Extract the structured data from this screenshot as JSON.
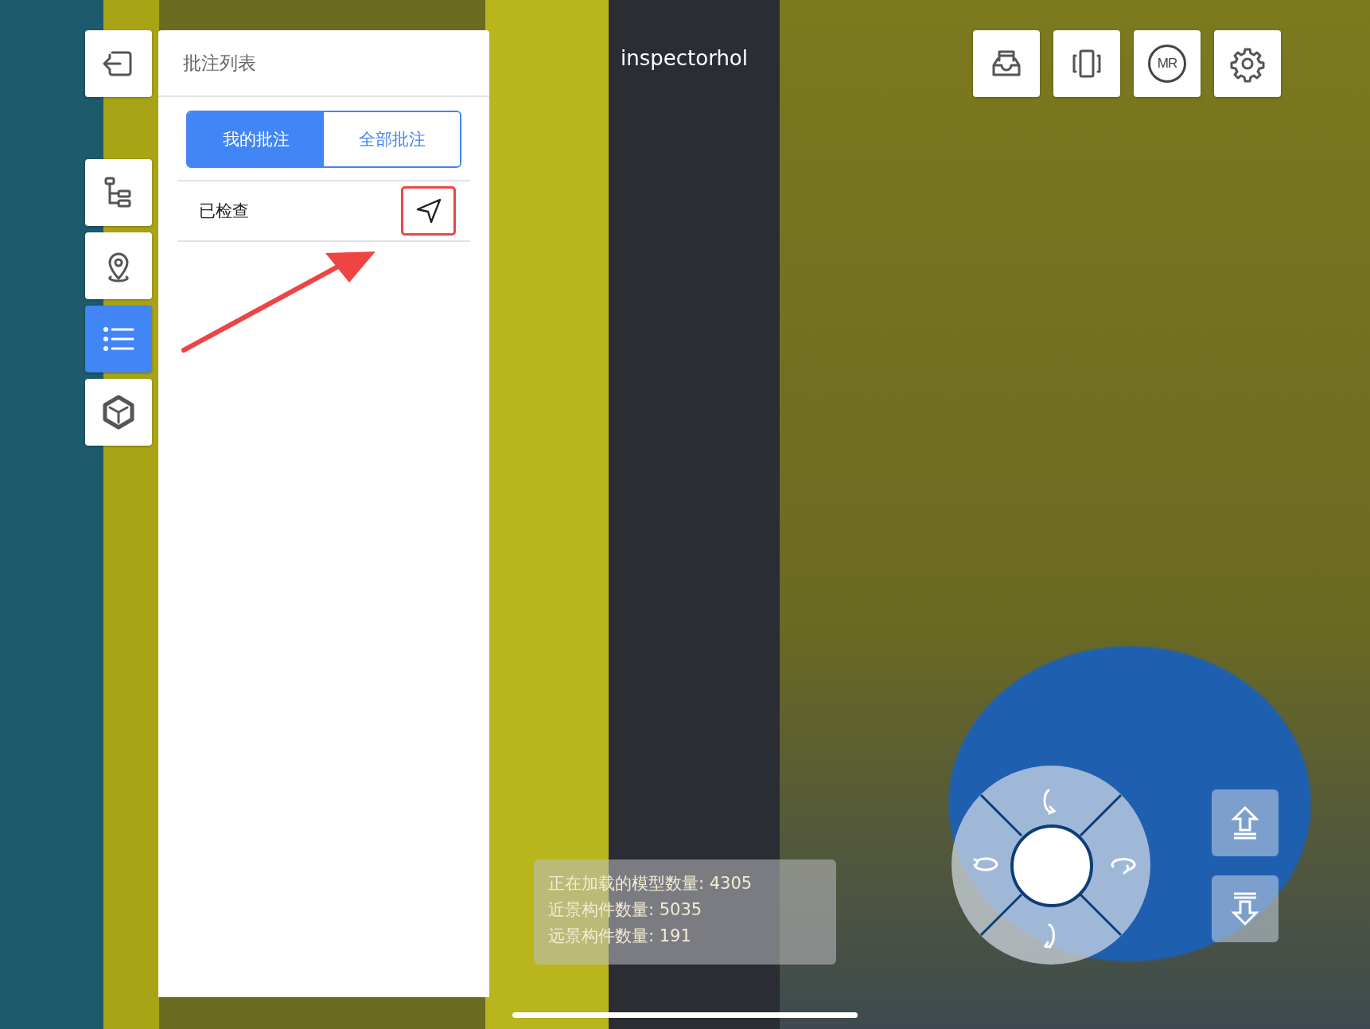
{
  "left_toolbar": {
    "items": [
      {
        "kind": "exit",
        "selected": false
      },
      {
        "kind": "tree",
        "selected": false
      },
      {
        "kind": "location",
        "selected": false
      },
      {
        "kind": "list",
        "selected": true
      },
      {
        "kind": "cube",
        "selected": false
      }
    ]
  },
  "annotation_panel": {
    "title": "批注列表",
    "tabs": [
      {
        "label": "我的批注",
        "selected": true
      },
      {
        "label": "全部批注",
        "selected": false
      }
    ],
    "items": [
      {
        "label": "已检查",
        "highlighted": true
      }
    ]
  },
  "username": "inspectorhol",
  "top_toolbar": {
    "items": [
      {
        "kind": "inbox"
      },
      {
        "kind": "rotate"
      },
      {
        "kind": "mr",
        "label": "MR"
      },
      {
        "kind": "settings"
      }
    ]
  },
  "stats": [
    "正在加载的模型数量: 4305",
    "近景构件数量: 5035",
    "远景构件数量: 191"
  ],
  "height_buttons": [
    {
      "kind": "up"
    },
    {
      "kind": "down"
    }
  ]
}
